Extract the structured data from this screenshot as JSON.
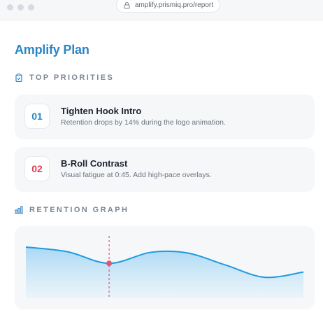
{
  "browser": {
    "url": "amplify.prismiq.pro/report"
  },
  "page": {
    "title": "Amplify Plan"
  },
  "priorities": {
    "heading": "TOP PRIORITIES",
    "items": [
      {
        "number": "01",
        "title": "Tighten Hook Intro",
        "description": "Retention drops by 14% during the logo animation.",
        "color": "#2a86c6"
      },
      {
        "number": "02",
        "title": "B-Roll Contrast",
        "description": "Visual fatigue at 0:45. Add high-pace overlays.",
        "color": "#e03b55"
      }
    ]
  },
  "retention": {
    "heading": "RETENTION GRAPH",
    "line_color": "#1f9be0",
    "marker_color": "#e0567a",
    "icons": {
      "priorities": "clipboard-check-icon",
      "graph": "bar-chart-icon"
    }
  },
  "chart_data": {
    "type": "area",
    "title": "",
    "xlabel": "",
    "ylabel": "",
    "x": [
      0,
      0.15,
      0.3,
      0.45,
      0.58,
      0.72,
      0.86,
      1.0
    ],
    "values": [
      0.88,
      0.8,
      0.6,
      0.79,
      0.78,
      0.57,
      0.36,
      0.45
    ],
    "marker_x": 0.3,
    "ylim": [
      0,
      1
    ],
    "grid": false,
    "legend": "none"
  }
}
